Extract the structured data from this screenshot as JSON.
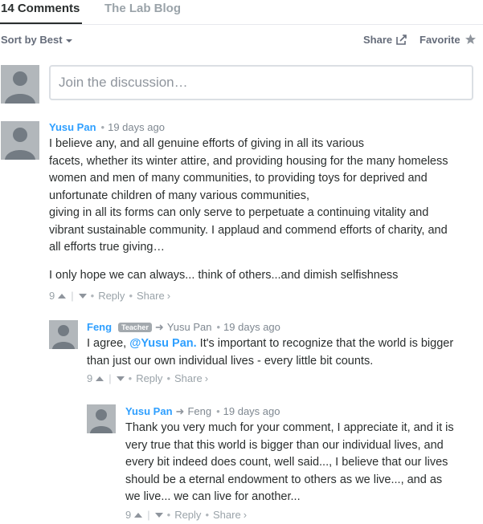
{
  "tabs": {
    "comments": "14 Comments",
    "community": "The Lab Blog"
  },
  "toolbar": {
    "sort": "Sort by Best",
    "share": "Share",
    "favorite": "Favorite"
  },
  "composer": {
    "placeholder": "Join the discussion…"
  },
  "colors": {
    "link": "#2e9fff",
    "text": "#2a2e2e",
    "muted": "#9aa3a9",
    "avatar": "#b2b7bb"
  },
  "icons": {
    "sort": "chevron-down-icon",
    "share": "share-icon",
    "favorite": "star-icon",
    "upvote": "upvote-icon",
    "downvote": "downvote-icon",
    "reply_arrow": "reply-arrow-icon"
  },
  "comments": [
    {
      "author": "Yusu Pan",
      "time": "19 days ago",
      "lines": [
        "I believe any, and all genuine efforts of giving in all its various",
        "facets, whether its winter attire, and providing housing for the many homeless",
        "women and men of many communities, to providing toys for deprived and",
        "unfortunate children of many various communities,",
        "giving in all its forms can only serve to perpetuate a continuing vitality and",
        "vibrant sustainable community. I applaud and commend efforts of charity, and",
        "all efforts true giving…",
        "I only hope we can always... think of others...and dimish selfishness"
      ],
      "votes": "9",
      "reply": "Reply",
      "share": "Share"
    },
    {
      "author": "Feng",
      "badge": "Teacher",
      "reply_to": "Yusu Pan",
      "time": "19 days ago",
      "line1_prefix": "I agree, ",
      "mention": "@Yusu Pan.",
      "line1_suffix": " It's important to recognize that the world is bigger",
      "line2": "than just our own individual lives - every little bit counts.",
      "votes": "9",
      "reply": "Reply",
      "share": "Share"
    },
    {
      "author": "Yusu Pan",
      "reply_to": "Feng",
      "time": "19 days ago",
      "lines": [
        "Thank you very much for your comment, I appreciate it, and it is",
        "very true that this world is bigger than our individual lives, and",
        "every bit indeed does count, well said..., I believe that our lives",
        "should be a eternal endowment to others as we live..., and as",
        "we live... we can live for another..."
      ],
      "votes": "9",
      "reply": "Reply",
      "share": "Share"
    }
  ]
}
